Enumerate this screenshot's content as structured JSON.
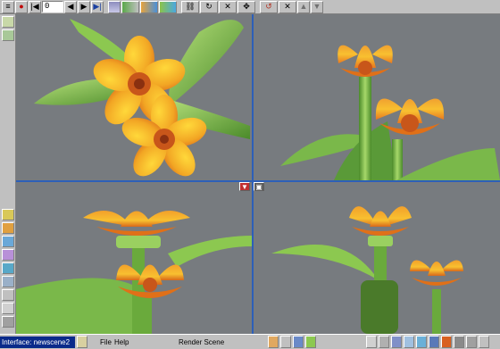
{
  "top_toolbar": {
    "frame_value": "0",
    "playback_buttons": [
      {
        "name": "record-button",
        "glyph": "●",
        "color": "#c00000"
      },
      {
        "name": "rewind-start-button",
        "glyph": "|◀",
        "color": "#000000"
      },
      {
        "name": "step-back-button",
        "glyph": "◀",
        "color": "#000000"
      },
      {
        "name": "step-forward-button",
        "glyph": "▶",
        "color": "#000000"
      },
      {
        "name": "fast-forward-end-button",
        "glyph": "▶|",
        "color": "#1a3fa0"
      }
    ]
  },
  "bottom_toolbar": {
    "scene_name": "Interface: newscene2",
    "menus": [
      "File",
      "Help"
    ],
    "status": "Render Scene"
  },
  "viewports": [
    "top-left-viewport",
    "top-right-viewport",
    "bottom-left-viewport",
    "bottom-right-viewport"
  ],
  "colors": {
    "viewport_bg": "#777b7f",
    "divider": "#2d5fb8",
    "petal_yellow": "#f6c21a",
    "petal_orange": "#e8781c",
    "leaf_green": "#7ab84a",
    "center": "#c8561a"
  }
}
